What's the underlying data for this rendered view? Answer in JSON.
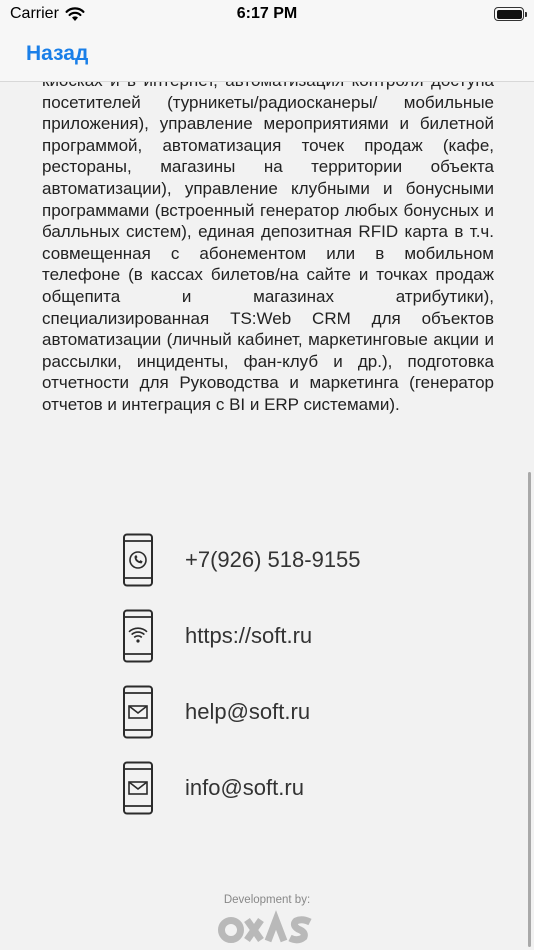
{
  "status_bar": {
    "carrier": "Carrier",
    "time": "6:17 PM"
  },
  "nav": {
    "back_label": "Назад"
  },
  "description": "киосках и в интернет, автоматизация контроля доступа посетителей (турникеты/радиосканеры/ мобильные приложения), управление мероприятиями и билетной программой, автоматизация точек продаж (кафе, рестораны, магазины на территории объекта автоматизации), управление клубными и бонусными программами (встроенный генератор любых бонусных и балльных систем), единая депозитная RFID карта в т.ч. совмещенная с абонементом или в мобильном телефоне (в кассах билетов/на сайте и точках продаж общепита и магазинах атрибутики), специализированная TS:Web CRM для объектов автоматизации (личный кабинет, маркетинговые акции и рассылки, инциденты, фан-клуб и др.), подготовка отчетности для Руководства и маркетинга (генератор отчетов и интеграция с BI и ERP системами).",
  "contacts": [
    {
      "icon": "phone-call-icon",
      "value": "+7(926) 518-9155"
    },
    {
      "icon": "phone-wifi-icon",
      "value": "https://soft.ru"
    },
    {
      "icon": "phone-mail-icon",
      "value": "help@soft.ru"
    },
    {
      "icon": "phone-mail-icon",
      "value": "info@soft.ru"
    }
  ],
  "footer": {
    "dev_label": "Development by:",
    "logo": "OXAS"
  },
  "colors": {
    "accent": "#1a7fe8",
    "background": "#f2f2f2",
    "text": "#222222"
  }
}
